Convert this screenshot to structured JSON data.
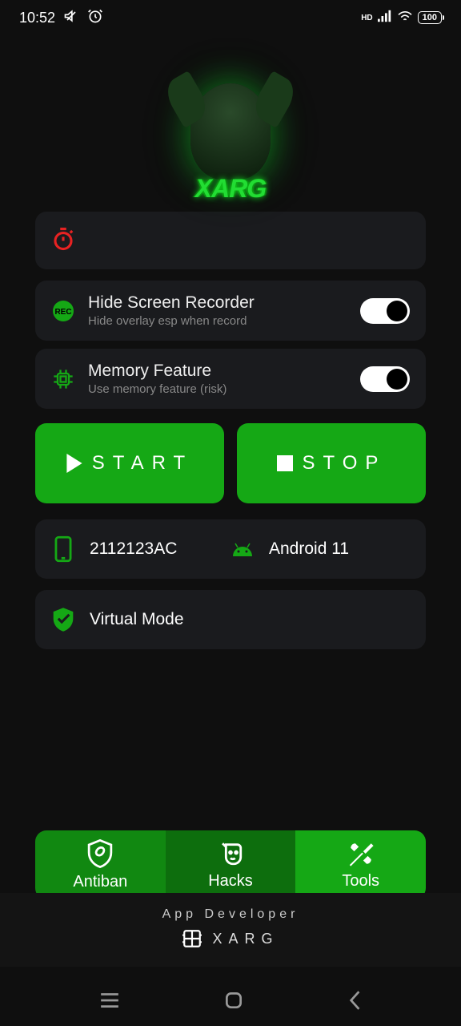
{
  "status": {
    "time": "10:52",
    "hd": "HD",
    "battery": "100"
  },
  "logo": {
    "text": "XARG"
  },
  "features": {
    "hide_recorder": {
      "title": "Hide Screen Recorder",
      "subtitle": "Hide overlay esp when record"
    },
    "memory": {
      "title": "Memory Feature",
      "subtitle": "Use memory feature (risk)"
    }
  },
  "buttons": {
    "start": "START",
    "stop": "STOP"
  },
  "device": {
    "model": "2112123AC",
    "os": "Android 11"
  },
  "mode": {
    "virtual": "Virtual Mode"
  },
  "tabs": {
    "antiban": "Antiban",
    "hacks": "Hacks",
    "tools": "Tools"
  },
  "footer": {
    "title": "App Developer",
    "brand": "XARG"
  }
}
